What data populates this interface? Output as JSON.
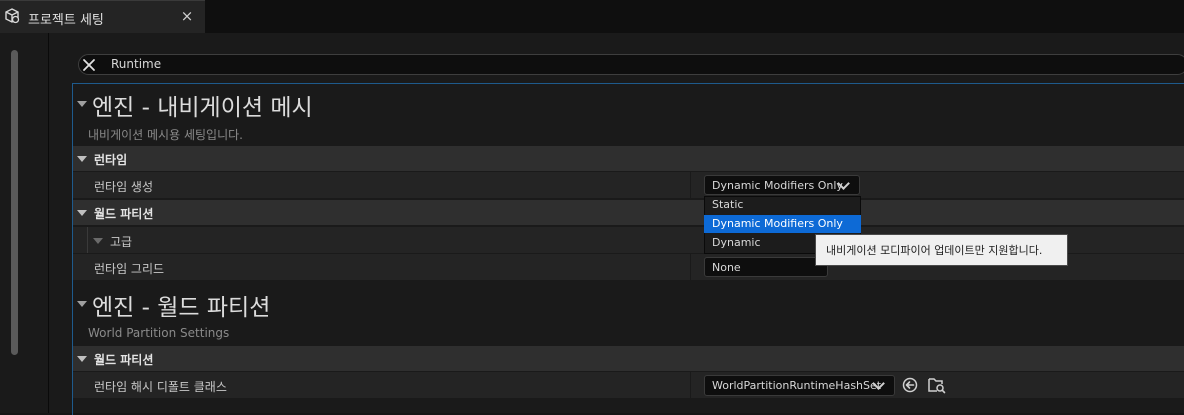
{
  "tab": {
    "title": "프로젝트 세팅",
    "close_label": "×"
  },
  "search": {
    "value": "Runtime"
  },
  "sections": [
    {
      "title": "엔진 - 내비게이션 메시",
      "description": "내비게이션 메시용 세팅입니다.",
      "categories": {
        "runtime": {
          "label": "런타임"
        },
        "world_partition": {
          "label": "월드 파티션"
        }
      },
      "properties": {
        "runtime_generation": {
          "label": "런타임 생성",
          "value": "Dynamic Modifiers Only"
        },
        "advanced": {
          "label": "고급"
        },
        "runtime_grid": {
          "label": "런타임 그리드",
          "value": "None"
        }
      }
    },
    {
      "title": "엔진 - 월드 파티션",
      "description": "World Partition Settings",
      "categories": {
        "world_partition": {
          "label": "월드 파티션"
        }
      },
      "properties": {
        "runtime_hash_class": {
          "label": "런타임 해시 디폴트 클래스",
          "value": "WorldPartitionRuntimeHashSet"
        }
      }
    }
  ],
  "dropdown": {
    "options": [
      "Static",
      "Dynamic Modifiers Only",
      "Dynamic"
    ],
    "selected": "Dynamic Modifiers Only"
  },
  "tooltip": {
    "text": "내비게이션 모디파이어 업데이트만 지원합니다."
  },
  "icons": {
    "tab": "settings-cubes-icon",
    "search_clear": "close-icon",
    "reset": "reset-arrow-icon",
    "browse": "browse-folder-icon"
  },
  "colors": {
    "accent": "#0d6ad6",
    "background": "#1a1a1a",
    "category_bar": "#2f2f2f",
    "row": "#242424",
    "tooltip_bg": "#f0f0f0"
  }
}
